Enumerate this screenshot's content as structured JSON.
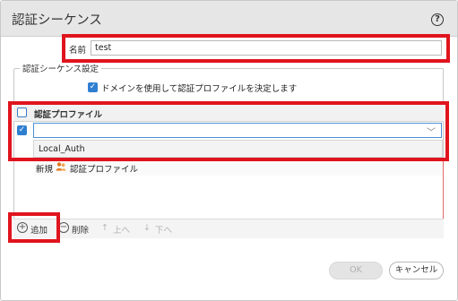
{
  "dialog": {
    "title": "認証シーケンス",
    "help_icon": "question-circle-icon",
    "help_glyph": "?"
  },
  "name_field": {
    "label": "名前",
    "value": "test"
  },
  "settings_group": {
    "legend": "認証シーケンス設定",
    "use_domain_checkbox": {
      "checked": true,
      "label": "ドメインを使用して認証プロファイルを決定します"
    }
  },
  "profile_table": {
    "column_header": "認証プロファイル",
    "row": {
      "checked": true,
      "value": ""
    },
    "chevron_icon": "chevron-down-icon",
    "dropdown_options": [
      "Local_Auth"
    ],
    "new_item": {
      "prefix": "新規",
      "icon": "auth-profile-icon",
      "label": "認証プロファイル"
    }
  },
  "toolbar": {
    "add": "追加",
    "delete": "削除",
    "move_up": "上へ",
    "move_down": "下へ"
  },
  "footer": {
    "ok": "OK",
    "cancel": "キャンセル"
  },
  "colors": {
    "highlight": "#e0141e",
    "accent": "#2f7fd1"
  }
}
